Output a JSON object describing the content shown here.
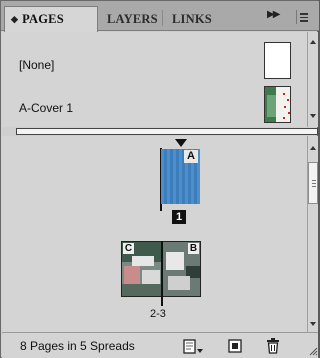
{
  "tabs": [
    {
      "label": "PAGES",
      "active": true
    },
    {
      "label": "LAYERS",
      "active": false
    },
    {
      "label": "LINKS",
      "active": false
    }
  ],
  "masters": {
    "items": [
      {
        "label": "[None]",
        "thumbnail": "blank-white"
      },
      {
        "label": "A-Cover 1",
        "thumbnail": "cover-art"
      }
    ]
  },
  "pages": {
    "page1": {
      "master_letter": "A",
      "number": "1",
      "color": "#3f86c7"
    },
    "spread": {
      "left_master": "C",
      "right_master": "B",
      "number": "2-3"
    }
  },
  "footer": {
    "status": "8 Pages in 5 Spreads",
    "buttons": [
      "edit-page-size-icon",
      "new-page-icon",
      "delete-page-icon"
    ]
  },
  "colors": {
    "panel_bg": "#d4d4d4",
    "tabbar_bg": "#a9a9a9",
    "page_blue": "#3f86c7"
  }
}
